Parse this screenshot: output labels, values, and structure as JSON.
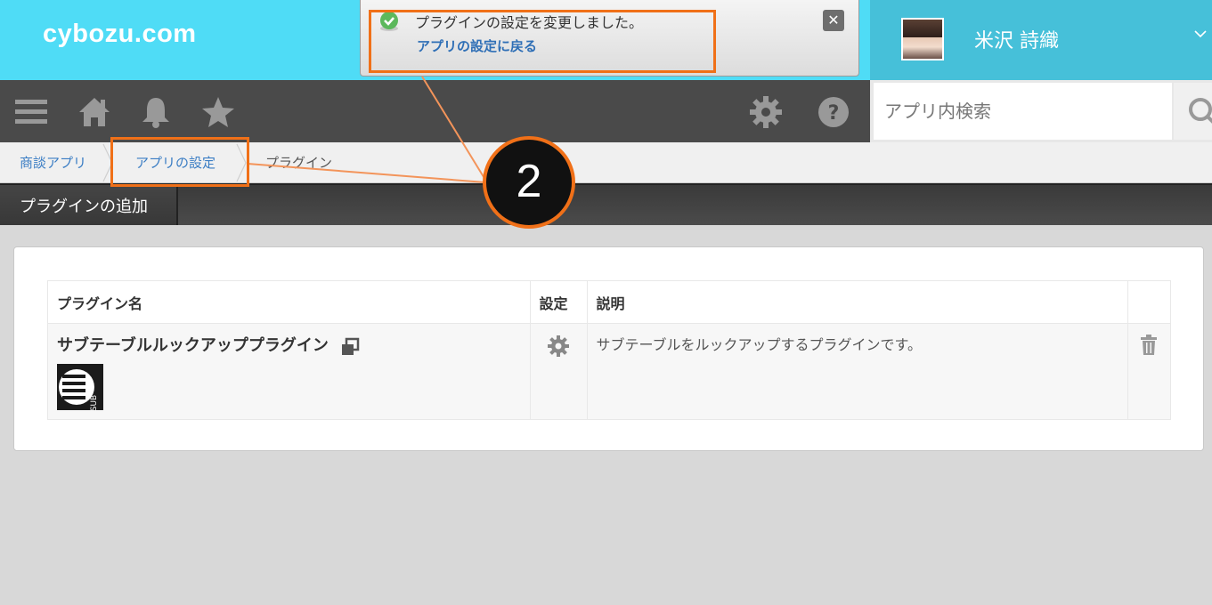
{
  "header": {
    "logo": "cybozu.com",
    "user_name": "米沢 詩織"
  },
  "notification": {
    "message": "プラグインの設定を変更しました。",
    "link": "アプリの設定に戻る",
    "close_label": "✕"
  },
  "navbar": {
    "icons": [
      "menu-icon",
      "home-icon",
      "bell-icon",
      "star-icon",
      "gear-icon",
      "help-icon"
    ]
  },
  "search": {
    "placeholder": "アプリ内検索"
  },
  "breadcrumb": {
    "items": [
      "商談アプリ",
      "アプリの設定",
      "プラグイン"
    ]
  },
  "tabs": {
    "add_plugin": "プラグインの追加"
  },
  "table": {
    "headers": [
      "プラグイン名",
      "設定",
      "説明"
    ],
    "rows": [
      {
        "name": "サブテーブルルックアッププラグイン",
        "description": "サブテーブルをルックアップするプラグインです。",
        "image_label": "SUB"
      }
    ]
  },
  "annotation": {
    "step": "2",
    "color": "#f07018"
  },
  "colors": {
    "header_bg": "#4fdcf6",
    "user_bg": "#46c0d9",
    "navbar_bg": "#4a4a4a",
    "link": "#3a7dc4",
    "annotation": "#f07018"
  }
}
